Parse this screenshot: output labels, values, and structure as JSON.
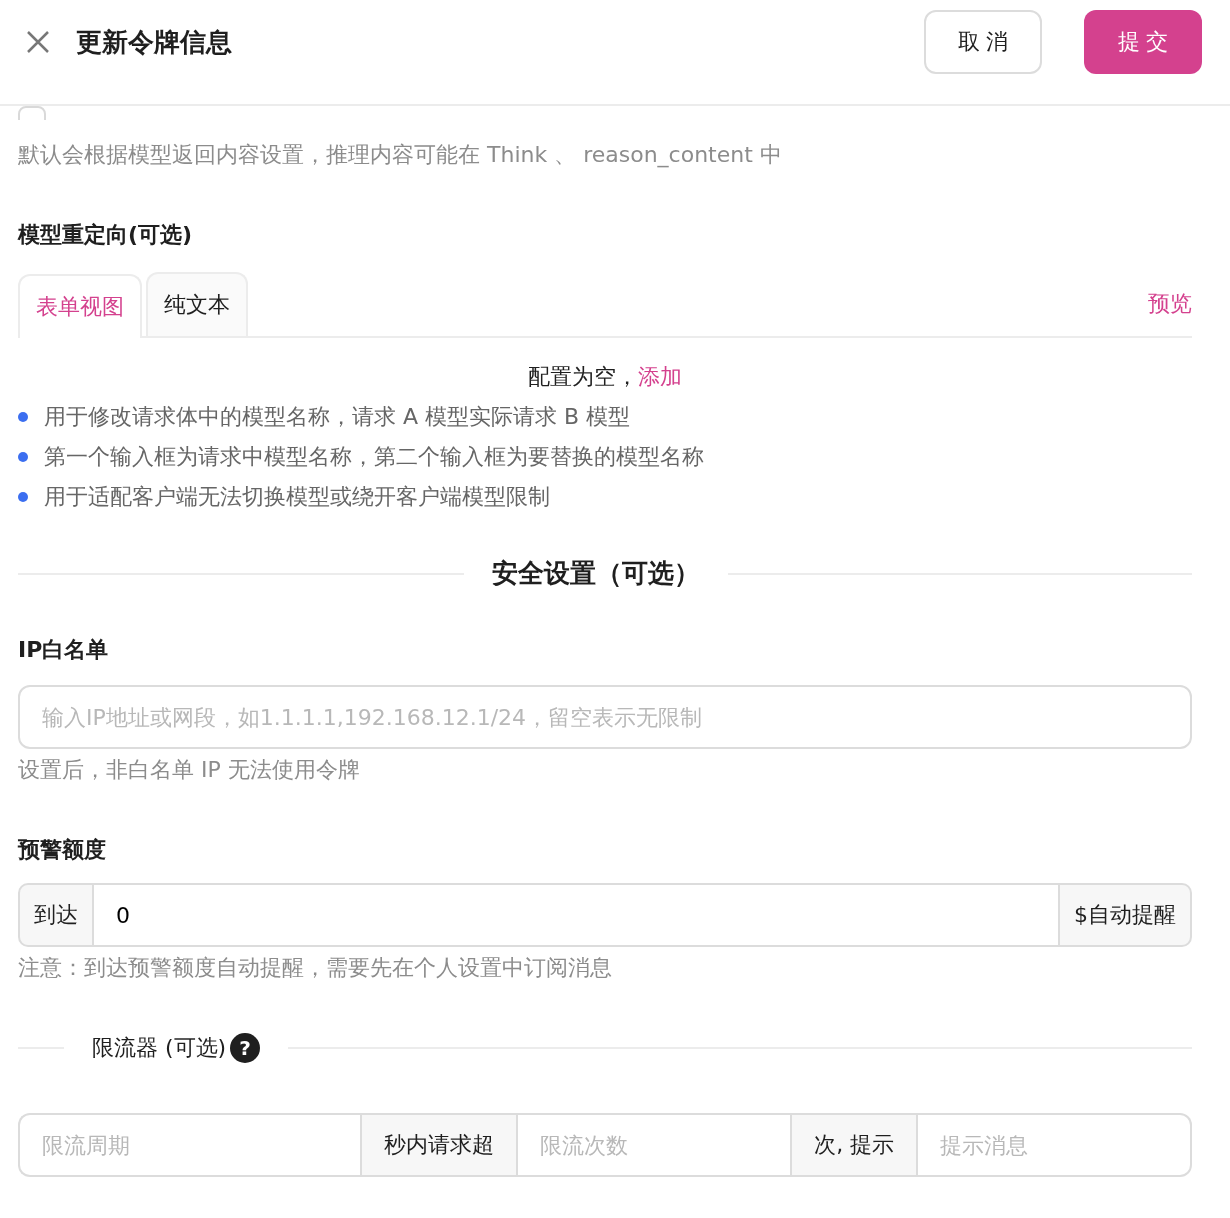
{
  "header": {
    "title": "更新令牌信息",
    "buttons": [
      {
        "label": "取 消",
        "kind": "secondary"
      },
      {
        "label": "提 交",
        "kind": "primary"
      }
    ]
  },
  "reason_option": {
    "checked": false,
    "hint": "默认会根据模型返回内容设置，推理内容可能在 Think 、 reason_content 中"
  },
  "model_redirect": {
    "label": "模型重定向(可选)",
    "tabs": [
      {
        "label": "表单视图",
        "selected": true
      },
      {
        "label": "纯文本",
        "selected": false
      }
    ],
    "preview": "预览",
    "empty_text": "配置为空，",
    "add_link": "添加",
    "notes": [
      "用于修改请求体中的模型名称，请求 A 模型实际请求 B 模型",
      "第一个输入框为请求中模型名称，第二个输入框为要替换的模型名称",
      "用于适配客户端无法切换模型或绕开客户端模型限制"
    ]
  },
  "security": {
    "title": "安全设置（可选）",
    "ip_label": "IP白名单",
    "ip_placeholder": "输入IP地址或网段，如1.1.1.1,192.168.12.1/24，留空表示无限制",
    "ip_hint": "设置后，非白名单 IP 无法使用令牌"
  },
  "alert": {
    "label": "预警额度",
    "prefix": "到达",
    "value": "0",
    "suffix": "$自动提醒",
    "hint": "注意：到达预警额度自动提醒，需要先在个人设置中订阅消息"
  },
  "limiter": {
    "title": "限流器 (可选)",
    "help": "?",
    "parts": [
      {
        "kind": "input",
        "placeholder": "限流周期"
      },
      {
        "kind": "addon",
        "label": "秒内请求超"
      },
      {
        "kind": "input",
        "placeholder": "限流次数"
      },
      {
        "kind": "addon",
        "label": "次, 提示"
      },
      {
        "kind": "input",
        "placeholder": "提示消息"
      }
    ]
  }
}
